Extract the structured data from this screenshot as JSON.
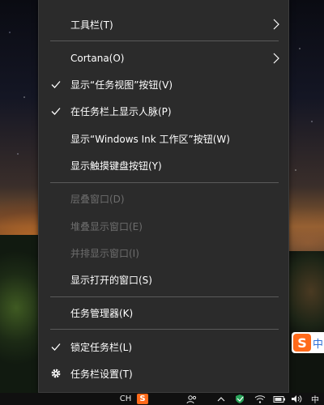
{
  "menu": {
    "items": [
      {
        "label": "工具栏(T)"
      },
      {
        "label": "Cortana(O)"
      },
      {
        "label": "显示“任务视图”按钮(V)"
      },
      {
        "label": "在任务栏上显示人脉(P)"
      },
      {
        "label": "显示“Windows Ink 工作区”按钮(W)"
      },
      {
        "label": "显示触摸键盘按钮(Y)"
      },
      {
        "label": "层叠窗口(D)"
      },
      {
        "label": "堆叠显示窗口(E)"
      },
      {
        "label": "并排显示窗口(I)"
      },
      {
        "label": "显示打开的窗口(S)"
      },
      {
        "label": "任务管理器(K)"
      },
      {
        "label": "锁定任务栏(L)"
      },
      {
        "label": "任务栏设置(T)"
      }
    ],
    "checked_items": [
      "显示“任务视图”按钮(V)",
      "在任务栏上显示人脉(P)",
      "锁定任务栏(L)"
    ],
    "disabled_items": [
      "层叠窗口(D)",
      "堆叠显示窗口(E)",
      "并排显示窗口(I)"
    ],
    "submenu_items": [
      "工具栏(T)",
      "Cortana(O)"
    ]
  },
  "tray_app": {
    "badge": "S",
    "text": "中"
  },
  "taskbar": {
    "language": "CH",
    "ime_badge": "S",
    "ime_mode": "中",
    "icons": [
      "people-icon",
      "chevron-up-icon",
      "shield-icon",
      "wifi-icon",
      "battery-icon",
      "volume-icon"
    ]
  },
  "colors": {
    "menu_bg": "#2b2b2b",
    "text": "#ffffff",
    "disabled_text": "#6d6d6d",
    "separator": "#5a5a5a",
    "ime_orange": "#ff6a1a"
  }
}
